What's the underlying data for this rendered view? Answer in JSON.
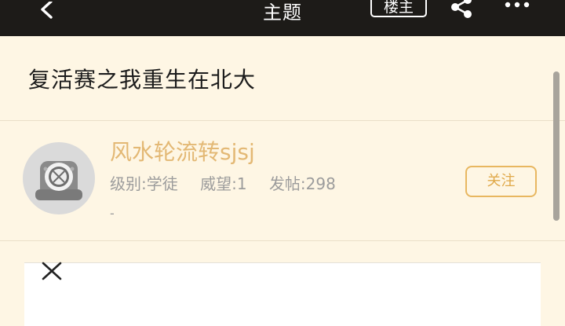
{
  "header": {
    "title": "主题",
    "op_badge_label": "楼主",
    "icons": [
      "back-icon",
      "share-icon",
      "more-icon"
    ]
  },
  "post": {
    "title": "复活赛之我重生在北大"
  },
  "author": {
    "name": "风水轮流转sjsj",
    "level": "级别:学徒",
    "prestige": "威望:1",
    "posts": "发帖:298",
    "signature": "-",
    "follow_label": "关注",
    "avatar_icon": "diving-helmet-avatar"
  },
  "ad": {
    "close_icon": "close-icon"
  },
  "colors": {
    "topbar": "#1D1B18",
    "background": "#FEF6E4",
    "accent": "#E3B874",
    "muted_text": "#9C9C9C"
  }
}
